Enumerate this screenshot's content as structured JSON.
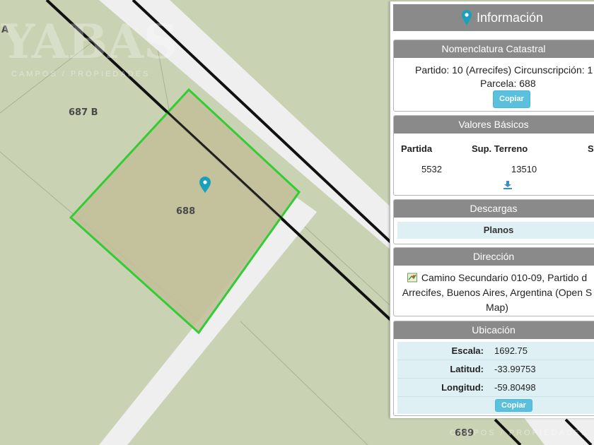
{
  "map": {
    "parcel_labels": {
      "left_partial": "A",
      "neighbor_top": "687 B",
      "selected": "688",
      "bottom": "689"
    },
    "colors": {
      "background": "#c9d3b4",
      "road": "#efefef",
      "parcel_fill": "#c2bf9a",
      "parcel_border": "#33cc33",
      "road_line": "#111111",
      "boundary": "#a7b394"
    },
    "marker_icon": "map-pin-icon"
  },
  "watermark": {
    "brand": "YABAS",
    "tagline": "CAMPOS / PROPIEDADES"
  },
  "panel": {
    "title": "Información",
    "title_icon": "map-pin-icon",
    "nomenclatura": {
      "header": "Nomenclatura Catastral",
      "line1": "Partido: 10 (Arrecifes) Circunscripción: 1",
      "line2": "Parcela: 688",
      "copy_label": "Copiar"
    },
    "valores": {
      "header": "Valores Básicos",
      "columns": [
        "Partida",
        "Sup. Terreno",
        "S"
      ],
      "row": [
        "5532",
        "13510"
      ],
      "download_icon": "download-icon"
    },
    "descargas": {
      "header": "Descargas",
      "planos": "Planos"
    },
    "direccion": {
      "header": "Dirección",
      "icon": "map-icon",
      "line1": "Camino Secundario 010-09, Partido d",
      "line2": "Arrecifes, Buenos Aires, Argentina (Open S",
      "line3": "Map)"
    },
    "ubicacion": {
      "header": "Ubicación",
      "rows": [
        {
          "label": "Escala:",
          "value": "1692.75"
        },
        {
          "label": "Latitud:",
          "value": "-33.99753"
        },
        {
          "label": "Longitud:",
          "value": "-59.80498"
        }
      ],
      "copy_label": "Copiar"
    }
  }
}
